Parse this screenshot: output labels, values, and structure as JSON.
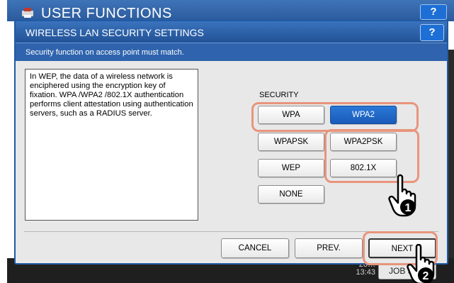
{
  "background": {
    "header_title": "USER FUNCTIONS",
    "help_label": "?",
    "datetime_line1": "20…",
    "datetime_line2": "13:43",
    "job_status_label": "JOB S…"
  },
  "dialog": {
    "title": "WIRELESS LAN SECURITY SETTINGS",
    "help_label": "?",
    "subtitle": "Security function on access point must match.",
    "description": "In WEP, the data of a wireless network is enciphered using the encryption key of fixation. WPA /WPA2 /802.1X authentication performs client attestation using authentication servers, such as a RADIUS server.",
    "security_label": "SECURITY",
    "security_options": {
      "wpa": "WPA",
      "wpa2": "WPA2",
      "wpapsk": "WPAPSK",
      "wpa2psk": "WPA2PSK",
      "wep": "WEP",
      "x8021": "802.1X",
      "none": "NONE"
    },
    "selected_option": "WPA2",
    "footer": {
      "cancel": "CANCEL",
      "prev": "PREV.",
      "next": "NEXT"
    }
  },
  "callouts": {
    "step1": "1",
    "step2": "2"
  },
  "colors": {
    "accent_blue": "#1d6fd6",
    "selected_button": "#1a5bb8",
    "highlight": "#e8957d"
  }
}
